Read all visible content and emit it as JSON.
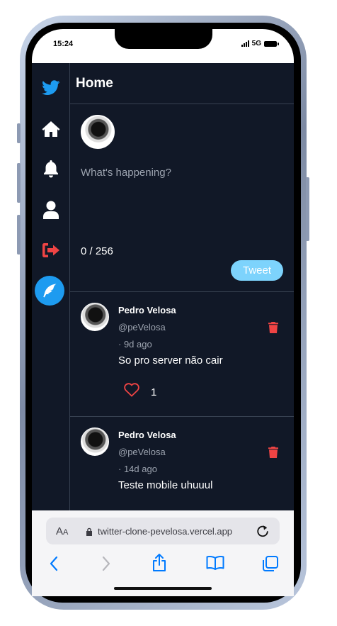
{
  "status_bar": {
    "time": "15:24",
    "network": "5G"
  },
  "sidebar": {
    "items": [
      {
        "icon": "twitter-bird-icon",
        "color": "#1d9bf0"
      },
      {
        "icon": "home-icon",
        "color": "#ffffff"
      },
      {
        "icon": "bell-icon",
        "color": "#ffffff"
      },
      {
        "icon": "user-icon",
        "color": "#ffffff"
      },
      {
        "icon": "logout-icon",
        "color": "#ef4444"
      }
    ],
    "compose_icon": "feather-icon"
  },
  "header": {
    "title": "Home"
  },
  "composer": {
    "placeholder": "What's happening?",
    "counter": "0 / 256",
    "tweet_label": "Tweet"
  },
  "posts": [
    {
      "name": "Pedro Velosa",
      "handle": "@peVelosa",
      "time": "· 9d ago",
      "text": "So pro server não cair",
      "likes": "1"
    },
    {
      "name": "Pedro Velosa",
      "handle": "@peVelosa",
      "time": "· 14d ago",
      "text": "Teste mobile uhuuul"
    }
  ],
  "browser": {
    "aa_label_big": "A",
    "aa_label_small": "A",
    "url": "twitter-clone-pevelosa.vercel.app"
  },
  "colors": {
    "app_bg": "#111827",
    "accent": "#1d9bf0",
    "tweet_button": "#7dd3fc",
    "danger": "#ef4444",
    "safari_blue": "#007aff"
  }
}
